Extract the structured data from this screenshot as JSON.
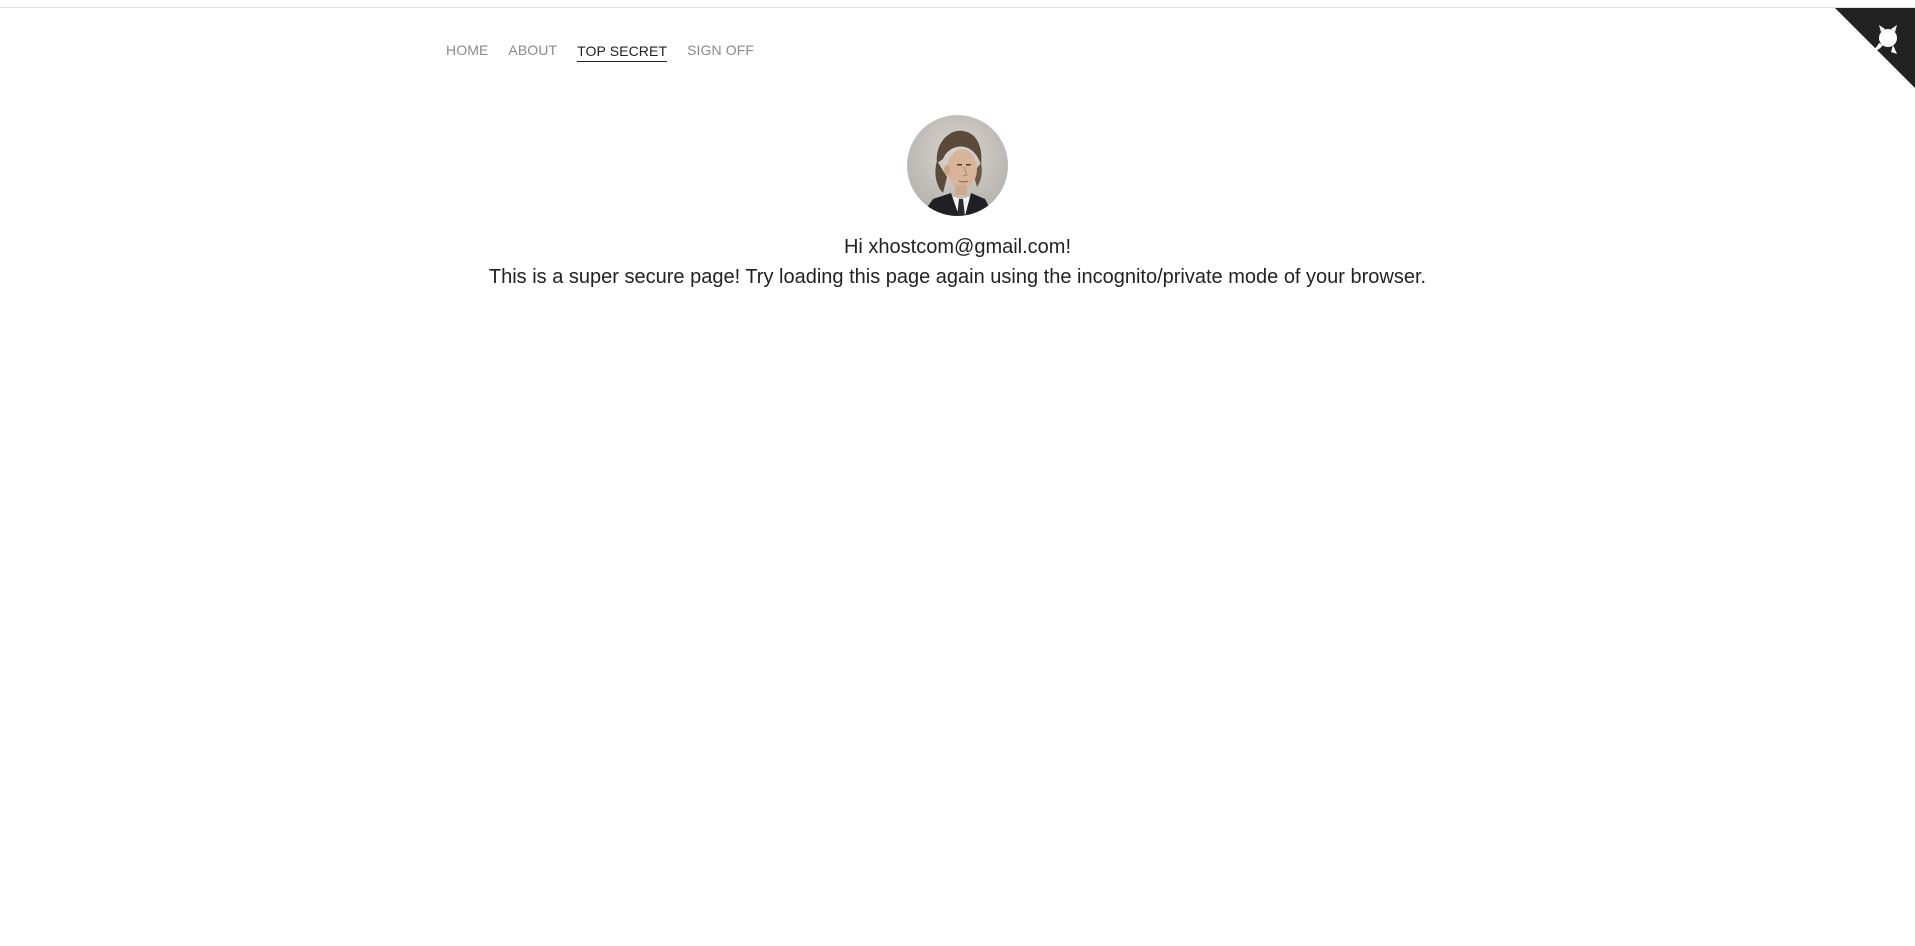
{
  "nav": {
    "items": [
      {
        "label": "HOME",
        "active": false
      },
      {
        "label": "ABOUT",
        "active": false
      },
      {
        "label": "TOP SECRET",
        "active": true
      },
      {
        "label": "SIGN OFF",
        "active": false
      }
    ]
  },
  "profile": {
    "avatar_icon": "user-photo",
    "greeting": "Hi xhostcom@gmail.com!",
    "message": "This is a super secure page! Try loading this page again using the incognito/private mode of your browser."
  },
  "corner_ribbon": {
    "icon": "octocat-icon",
    "color": "#222222"
  }
}
